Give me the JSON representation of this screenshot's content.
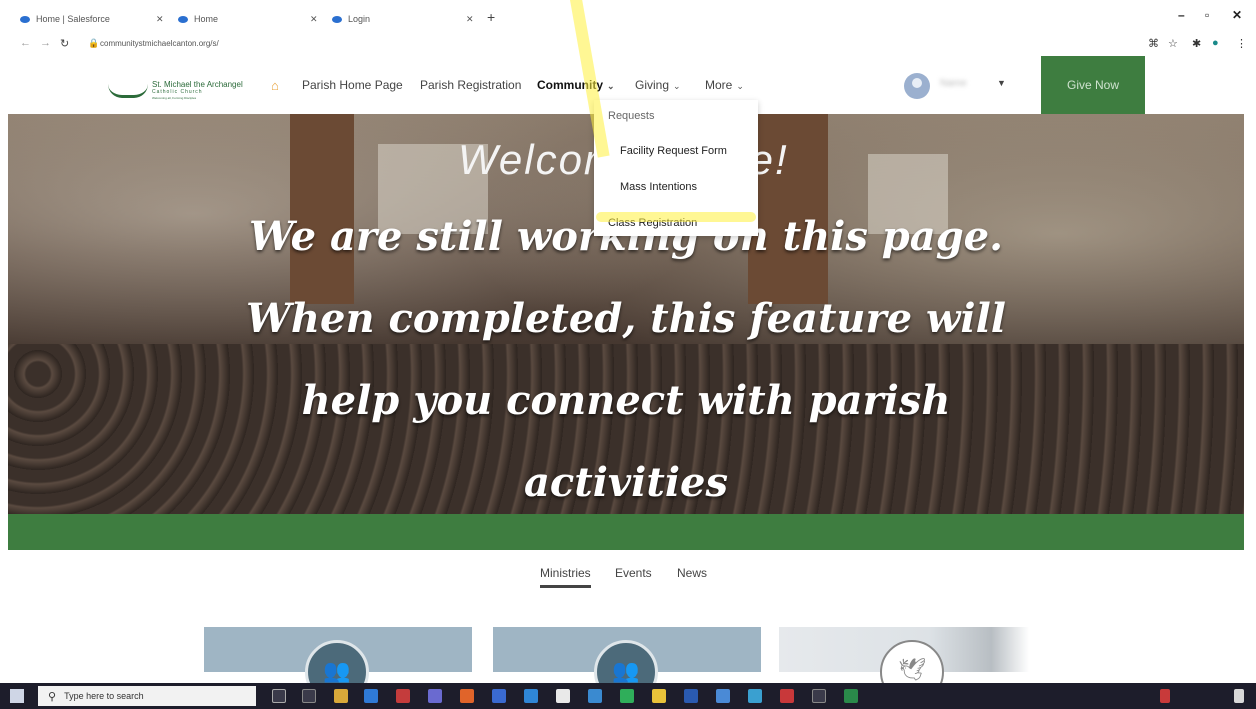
{
  "browser": {
    "tabs": [
      {
        "title": "Home | Salesforce"
      },
      {
        "title": "Home"
      },
      {
        "title": "Login"
      }
    ],
    "url": "communitystmichaelcanton.org/s/"
  },
  "header": {
    "logo": {
      "name": "St. Michael the Archangel",
      "sub": "Catholic Church",
      "tagline": "Welcoming all, Forming Disciples"
    },
    "nav": {
      "parish_home": "Parish Home Page",
      "parish_registration": "Parish Registration",
      "community": "Community",
      "giving": "Giving",
      "more": "More"
    },
    "user_name": "Name",
    "give_now": "Give Now"
  },
  "dropdown": {
    "heading": "Requests",
    "items": [
      "Facility Request Form",
      "Mass Intentions",
      "Class Registration"
    ]
  },
  "hero": {
    "welcome": "Welcome Place!",
    "lines": [
      "We are still working on this page.",
      "When completed, this feature will",
      "help you connect with parish",
      "activities"
    ]
  },
  "subtabs": [
    "Ministries",
    "Events",
    "News"
  ],
  "taskbar": {
    "search_placeholder": "Type here to search"
  },
  "colors": {
    "brand_green": "#3e7d40",
    "highlight": "#fff03c"
  }
}
